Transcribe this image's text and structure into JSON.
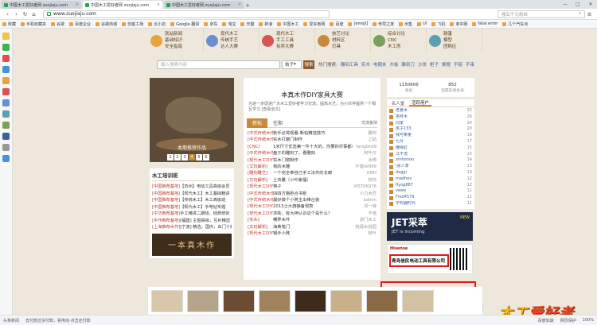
{
  "browser": {
    "tabs": [
      {
        "label": "中国木工爱好者网 zuojiaju.com",
        "active": false
      },
      {
        "label": "中国木工爱好者网 zuojiaju.com",
        "active": true
      },
      {
        "label": "中国木工爱好者网 zuojiaju.com",
        "active": false
      }
    ],
    "url": "www.zuojiaju.com",
    "search_placeholder": "搜五千元粉丝",
    "bookmarks": [
      "收藏",
      "手机收藏夹",
      "谷歌",
      "百度企业",
      "谷歌商城",
      "创客工场",
      "云小店",
      "Google 翻译",
      "京东",
      "淘宝",
      "天猫",
      "新浪",
      "中国木工",
      "爱好者网",
      "百度",
      "[emoji]",
      "传导之家",
      "出售",
      "UI",
      "飞机",
      "家中网",
      "fatal error",
      "几个汽车点"
    ],
    "status_left": "头条新闻",
    "status_mid": "去付款还没付款，看电动·点击还付款",
    "status_right": [
      "百度加速",
      "网页保护",
      "100%"
    ]
  },
  "site": {
    "nav_groups": [
      {
        "lines": [
          "就站新闻",
          "基础知识",
          "安全指南"
        ],
        "icon_color": "#e8a33a"
      },
      {
        "lines": [
          "现代木工",
          "传统手艺",
          "达人大赛"
        ],
        "icon_color": "#6a8fd0"
      },
      {
        "lines": [
          "现代木工",
          "手工工具",
          "有序大赛"
        ],
        "icon_color": "#d9534f"
      },
      {
        "lines": [
          "技艺讨论",
          "材料区",
          "灯具"
        ],
        "icon_color": "#c88a3b"
      },
      {
        "lines": [
          "综合讨论",
          "CNC",
          "木工房"
        ],
        "icon_color": "#7aa05a"
      },
      {
        "lines": [
          "跳蚤",
          "模型",
          "团购区"
        ],
        "icon_color": "#5aa0b0"
      }
    ],
    "search": {
      "placeholder": "输入搜索内容",
      "select": "帖子",
      "button": "搜索",
      "hot_label": "热门搜索:",
      "hot": [
        "雕刻工具",
        "实木",
        "电锯夹",
        "木板",
        "雕刻刀",
        "沙发",
        "柜子",
        "紫檀",
        "手链",
        "手串"
      ]
    },
    "hero": {
      "caption": "本期推荐作品",
      "pages": [
        "1",
        "2",
        "3",
        "4",
        "5",
        "6"
      ],
      "active_page": "4"
    },
    "training": {
      "title": "木工培训班",
      "rows": [
        {
          "tag": "[中国推荐基地]",
          "text": "【苏州】电动工具高级会员"
        },
        {
          "tag": "[中国推荐基地]",
          "text": "【现代木工】木工基础精讲"
        },
        {
          "tag": "[中国推荐基地]",
          "text": "【传统木工】木工高级班"
        },
        {
          "tag": "[中国推荐基地]",
          "text": "【现代木工】手电钻专题"
        },
        {
          "tag": "[中华推荐基地]",
          "text": "手工精讲二期班，经典培训"
        },
        {
          "tag": "[手作推荐基地]",
          "text": "[福建] 主题高级，互补精选"
        },
        {
          "tag": "[上海推荐木作]",
          "text": "[宁波] 精选，国庆，出门十好手"
        }
      ],
      "ad_text": "一本真木作"
    },
    "feature": {
      "title": "本真木作DIY家具大赛",
      "desc": "为进一步促进广大木工爱好者学习交流，提高木艺，为小伙伴提供一个相互学习 [查看全文]",
      "tabs": [
        "新帖",
        "往期"
      ],
      "tab_right": "交流板块",
      "rows": [
        {
          "tag": "[中式传统木作]",
          "subject": "新手必将观看-新帖精选技巧",
          "user": "雕刻"
        },
        {
          "tag": "[中式传统木作]",
          "subject": "实木打磨门制作",
          "user": "之助"
        },
        {
          "tag": "[CNC]",
          "subject": "1米尺寸优选第一件十大的，你要的尽事都可以",
          "user": "fangbird9"
        },
        {
          "tag": "[中式传统木作]",
          "subject": "盘子的雕刻了，看雕刻",
          "user": "阿叶仔"
        },
        {
          "tag": "[现代木工DIY]",
          "subject": "实木门窗制作",
          "user": "冰燃"
        },
        {
          "tag": "[文玩解析]",
          "subject": "我的木雕",
          "user": "不错lik999"
        },
        {
          "tag": "[雕刻雕艺]",
          "subject": "一个完全拳自己手工法件的长廊",
          "user": "KMH"
        },
        {
          "tag": "[文玩解析]",
          "subject": "土块雕（小叶紫檀）",
          "user": "拼你"
        },
        {
          "tag": "[现代木工DIY]",
          "subject": "筷子",
          "user": "W5T0K976"
        },
        {
          "tag": "[中式传统木作]",
          "subject": "四四方格柜合书柜",
          "user": "小刀木匠"
        },
        {
          "tag": "[中式传统木作]",
          "subject": "最好做个小凳主出棒台装",
          "user": "admin"
        },
        {
          "tag": "[现代木工DIY]",
          "subject": "2013土大旗静备现款",
          "user": "邓一峰"
        },
        {
          "tag": "[现代木工DIY]",
          "subject": "求助，有大神认识这个是什么？",
          "user": "不值"
        },
        {
          "tag": "[实木]",
          "subject": "嘲弄木件",
          "user": "游门木工"
        },
        {
          "tag": "[文玩解析]",
          "subject": "海黄笔门",
          "user": "桃源木桃园"
        },
        {
          "tag": "[现代木工DIY]",
          "subject": "钢手小凳",
          "user": "阿叶"
        }
      ]
    },
    "stats": [
      {
        "value": "1150606",
        "label": "会员"
      },
      {
        "value": "852",
        "label": "当前在线会员"
      }
    ],
    "user_tabs": [
      "名人堂",
      "活跃用户"
    ],
    "users": [
      {
        "name": "老姜木",
        "count": "32"
      },
      {
        "name": "搭林木",
        "count": "26"
      },
      {
        "name": "同家",
        "count": "24"
      },
      {
        "name": "房子133",
        "count": "20"
      },
      {
        "name": "我可乘量",
        "count": "19"
      },
      {
        "name": "七月",
        "count": "17"
      },
      {
        "name": "雕缘匠",
        "count": "15"
      },
      {
        "name": "江不流",
        "count": "15"
      },
      {
        "name": "xinhonoo",
        "count": "14"
      },
      {
        "name": "\\喜人季",
        "count": "13"
      },
      {
        "name": "daggi",
        "count": "13"
      },
      {
        "name": "madhex",
        "count": "12"
      },
      {
        "name": "fiyog887",
        "count": "12"
      },
      {
        "name": "vewe",
        "count": "11"
      },
      {
        "name": "Fred4579",
        "count": "11"
      },
      {
        "name": "中石器时代",
        "count": "11"
      }
    ],
    "ad_jet": {
      "title": "JET采萃",
      "slogan": "JET is incoming",
      "badge": "NEW"
    },
    "ad_company": {
      "brand": "Hisense",
      "name": "青岛信民电动工具有限公司"
    },
    "logo": {
      "part1": "木工",
      "part2": "爱好者"
    },
    "back_top": "△"
  },
  "colors": {
    "accent": "#c88a3b",
    "link": "#3c5fa0",
    "tag": "#c0392b",
    "highlight": "#e21a1a"
  }
}
